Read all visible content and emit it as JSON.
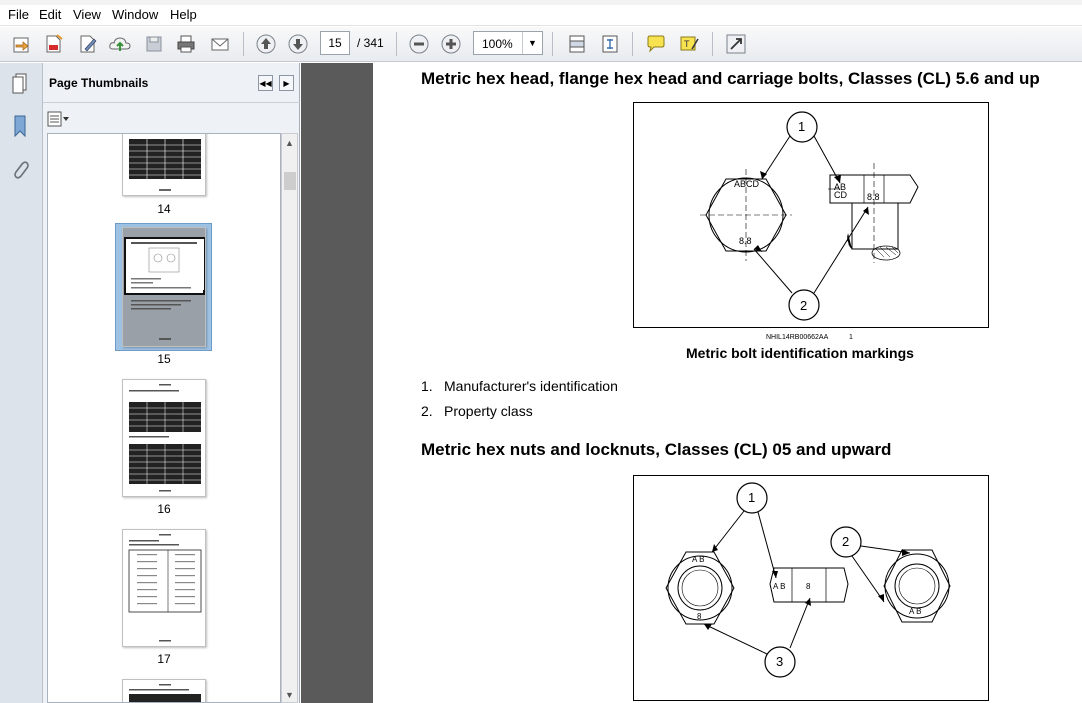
{
  "menu": [
    "File",
    "Edit",
    "View",
    "Window",
    "Help"
  ],
  "toolbar": {
    "page_current": "15",
    "page_total": "/ 341",
    "zoom": "100%"
  },
  "panel": {
    "title": "Page Thumbnails"
  },
  "thumbnails": [
    {
      "label": "14"
    },
    {
      "label": "15",
      "selected": true
    },
    {
      "label": "16"
    },
    {
      "label": "17"
    }
  ],
  "document": {
    "heading1": "Metric hex head, flange hex head and carriage bolts, Classes (CL) 5.6 and up",
    "figure1": {
      "callout1": "1",
      "callout2": "2",
      "mark_abcd": "ABCD",
      "mark_ab": "AB",
      "mark_cd": "CD",
      "grade_head": "8.8",
      "grade_side": "8.8",
      "code": "NHIL14RB00662AA",
      "code_num": "1",
      "caption": "Metric bolt identification markings"
    },
    "list": [
      {
        "num": "1.",
        "text": "Manufacturer's identification"
      },
      {
        "num": "2.",
        "text": "Property class"
      }
    ],
    "heading2": "Metric hex nuts and locknuts, Classes (CL) 05 and upward",
    "figure2": {
      "callout1": "1",
      "callout2": "2",
      "callout3": "3",
      "mark_ab_1": "A B",
      "mark_ab_2": "A B",
      "mark_ab_3": "A B",
      "grade_1": "8",
      "grade_2": "8"
    }
  }
}
